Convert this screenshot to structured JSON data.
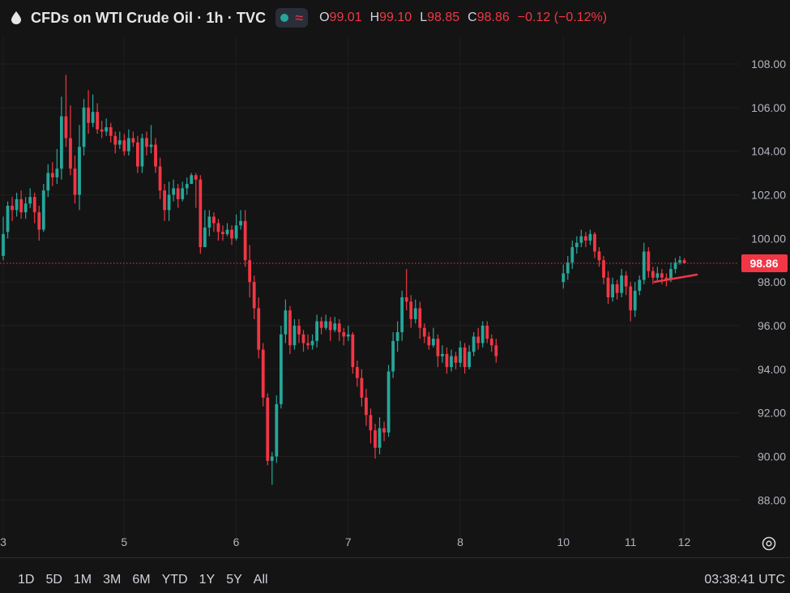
{
  "header": {
    "title": "CFDs on WTI Crude Oil · 1h · TVC",
    "open_label": "O",
    "open": "99.01",
    "high_label": "H",
    "high": "99.10",
    "low_label": "L",
    "low": "98.85",
    "close_label": "C",
    "close": "98.86",
    "change": "−0.12 (−0.12%)"
  },
  "price_tag": "98.86",
  "range_buttons": [
    "1D",
    "5D",
    "1M",
    "3M",
    "6M",
    "YTD",
    "1Y",
    "5Y",
    "All"
  ],
  "clock": "03:38:41 UTC",
  "colors": {
    "up": "#26a69a",
    "down": "#f23645",
    "background": "#141414",
    "grid": "#1f1f1f"
  },
  "chart_data": {
    "type": "candlestick",
    "title": "CFDs on WTI Crude Oil · 1h · TVC",
    "y_ticks": [
      "88.00",
      "90.00",
      "92.00",
      "94.00",
      "96.00",
      "98.00",
      "100.00",
      "102.00",
      "104.00",
      "106.00",
      "108.00"
    ],
    "ylim": [
      86.6,
      109.3
    ],
    "x_ticks": [
      {
        "label": "3",
        "x": 0
      },
      {
        "label": "5",
        "x": 27
      },
      {
        "label": "6",
        "x": 52
      },
      {
        "label": "7",
        "x": 77
      },
      {
        "label": "8",
        "x": 102
      },
      {
        "label": "10",
        "x": 125
      },
      {
        "label": "11",
        "x": 140
      },
      {
        "label": "12",
        "x": 152
      }
    ],
    "last_price": 98.86,
    "candles": [
      [
        0,
        99.2,
        100.2,
        101.0,
        99.0
      ],
      [
        1,
        100.3,
        101.5,
        101.7,
        100.0
      ],
      [
        2,
        101.5,
        101.3,
        101.9,
        100.8
      ],
      [
        3,
        101.3,
        101.8,
        102.1,
        101.0
      ],
      [
        4,
        101.8,
        101.2,
        102.2,
        100.9
      ],
      [
        5,
        101.2,
        101.6,
        101.9,
        100.9
      ],
      [
        6,
        101.6,
        101.9,
        102.3,
        101.4
      ],
      [
        7,
        101.9,
        101.2,
        102.1,
        100.7
      ],
      [
        8,
        101.2,
        100.4,
        101.5,
        99.9
      ],
      [
        9,
        100.4,
        102.2,
        102.5,
        100.3
      ],
      [
        10,
        102.2,
        103.0,
        103.4,
        101.9
      ],
      [
        11,
        103.0,
        102.8,
        103.5,
        102.4
      ],
      [
        12,
        102.8,
        103.2,
        104.1,
        102.5
      ],
      [
        13,
        103.2,
        105.6,
        106.5,
        102.7
      ],
      [
        14,
        105.6,
        104.6,
        107.5,
        104.2
      ],
      [
        15,
        104.6,
        103.2,
        106.1,
        102.9
      ],
      [
        16,
        103.2,
        102.0,
        103.8,
        101.6
      ],
      [
        17,
        102.0,
        104.2,
        105.2,
        101.3
      ],
      [
        18,
        104.2,
        106.0,
        106.4,
        103.8
      ],
      [
        19,
        106.0,
        105.3,
        106.8,
        104.8
      ],
      [
        20,
        105.3,
        105.8,
        106.6,
        105.1
      ],
      [
        21,
        105.8,
        105.0,
        106.2,
        104.8
      ],
      [
        22,
        105.0,
        104.9,
        105.4,
        104.6
      ],
      [
        23,
        104.9,
        105.1,
        105.5,
        104.7
      ],
      [
        24,
        105.1,
        104.7,
        105.3,
        104.4
      ],
      [
        25,
        104.7,
        104.3,
        104.9,
        103.9
      ],
      [
        26,
        104.3,
        104.5,
        104.9,
        104.1
      ],
      [
        27,
        104.5,
        104.0,
        104.8,
        103.8
      ],
      [
        28,
        104.0,
        104.6,
        105.0,
        103.8
      ],
      [
        29,
        104.6,
        104.4,
        104.9,
        104.2
      ],
      [
        30,
        104.4,
        103.3,
        104.7,
        103.0
      ],
      [
        31,
        103.3,
        104.6,
        104.8,
        103.0
      ],
      [
        32,
        104.6,
        104.2,
        104.9,
        103.8
      ],
      [
        33,
        104.2,
        104.3,
        105.2,
        103.9
      ],
      [
        34,
        104.3,
        103.3,
        104.6,
        103.0
      ],
      [
        35,
        103.3,
        102.2,
        103.7,
        101.8
      ],
      [
        36,
        102.2,
        101.3,
        102.5,
        100.8
      ],
      [
        37,
        101.3,
        102.0,
        102.6,
        100.8
      ],
      [
        38,
        102.0,
        102.3,
        102.7,
        101.7
      ],
      [
        39,
        102.3,
        101.8,
        102.5,
        101.4
      ],
      [
        40,
        101.8,
        102.3,
        102.6,
        101.7
      ],
      [
        41,
        102.3,
        102.5,
        102.8,
        102.0
      ],
      [
        42,
        102.5,
        102.9,
        103.0,
        102.5
      ],
      [
        43,
        102.9,
        102.7,
        103.0,
        101.4
      ],
      [
        44,
        102.7,
        99.6,
        102.9,
        99.3
      ],
      [
        45,
        99.6,
        100.5,
        101.3,
        99.6
      ],
      [
        46,
        100.5,
        101.0,
        101.3,
        100.1
      ],
      [
        47,
        101.0,
        100.7,
        101.2,
        100.3
      ],
      [
        48,
        100.7,
        100.3,
        100.9,
        99.9
      ],
      [
        49,
        100.3,
        100.2,
        100.6,
        99.9
      ],
      [
        50,
        100.2,
        100.4,
        100.7,
        100.1
      ],
      [
        51,
        100.4,
        100.0,
        100.6,
        99.7
      ],
      [
        52,
        100.0,
        100.6,
        101.1,
        99.9
      ],
      [
        53,
        100.6,
        100.8,
        101.3,
        100.4
      ],
      [
        54,
        100.8,
        99.0,
        101.3,
        98.7
      ],
      [
        55,
        99.0,
        98.0,
        99.7,
        97.3
      ],
      [
        56,
        98.0,
        96.8,
        98.3,
        96.3
      ],
      [
        57,
        96.8,
        94.9,
        97.3,
        94.5
      ],
      [
        58,
        94.9,
        92.7,
        95.2,
        92.3
      ],
      [
        59,
        92.7,
        89.8,
        92.9,
        89.6
      ],
      [
        60,
        89.8,
        90.0,
        90.2,
        88.7
      ],
      [
        61,
        90.0,
        92.4,
        92.8,
        89.7
      ],
      [
        62,
        92.4,
        95.6,
        96.0,
        92.2
      ],
      [
        63,
        95.6,
        96.7,
        97.2,
        95.2
      ],
      [
        64,
        96.7,
        95.1,
        96.9,
        94.7
      ],
      [
        65,
        95.1,
        96.0,
        96.3,
        94.9
      ],
      [
        66,
        96.0,
        95.6,
        96.3,
        95.2
      ],
      [
        67,
        95.6,
        95.2,
        95.8,
        94.8
      ],
      [
        68,
        95.2,
        95.1,
        95.6,
        94.9
      ],
      [
        69,
        95.1,
        95.3,
        95.6,
        94.9
      ],
      [
        70,
        95.3,
        96.2,
        96.5,
        95.0
      ],
      [
        71,
        96.2,
        95.9,
        96.4,
        95.6
      ],
      [
        72,
        95.9,
        96.2,
        96.5,
        95.8
      ],
      [
        73,
        96.2,
        95.8,
        96.4,
        95.3
      ],
      [
        74,
        95.8,
        96.1,
        96.4,
        95.7
      ],
      [
        75,
        96.1,
        95.7,
        96.3,
        95.3
      ],
      [
        76,
        95.7,
        95.5,
        95.9,
        95.1
      ],
      [
        77,
        95.5,
        95.6,
        96.0,
        95.3
      ],
      [
        78,
        95.6,
        94.1,
        95.7,
        93.8
      ],
      [
        79,
        94.1,
        93.6,
        94.4,
        93.2
      ],
      [
        80,
        93.6,
        92.7,
        94.0,
        92.3
      ],
      [
        81,
        92.7,
        91.9,
        93.1,
        91.4
      ],
      [
        82,
        91.9,
        91.2,
        92.2,
        90.6
      ],
      [
        83,
        91.2,
        90.4,
        91.5,
        89.9
      ],
      [
        84,
        90.4,
        91.3,
        91.8,
        90.1
      ],
      [
        85,
        91.3,
        91.1,
        91.6,
        90.7
      ],
      [
        86,
        91.1,
        93.9,
        94.2,
        90.9
      ],
      [
        87,
        93.9,
        95.3,
        95.7,
        93.6
      ],
      [
        88,
        95.3,
        95.7,
        96.2,
        94.8
      ],
      [
        89,
        95.7,
        97.3,
        97.6,
        95.3
      ],
      [
        90,
        97.3,
        97.1,
        98.6,
        96.7
      ],
      [
        91,
        97.1,
        96.3,
        97.4,
        95.9
      ],
      [
        92,
        96.3,
        96.8,
        97.2,
        96.1
      ],
      [
        93,
        96.8,
        95.9,
        97.1,
        95.4
      ],
      [
        94,
        95.9,
        95.5,
        96.1,
        95.2
      ],
      [
        95,
        95.5,
        95.1,
        95.7,
        94.9
      ],
      [
        96,
        95.1,
        95.4,
        95.9,
        95.0
      ],
      [
        97,
        95.4,
        94.6,
        95.6,
        94.1
      ],
      [
        98,
        94.6,
        94.7,
        95.1,
        94.3
      ],
      [
        99,
        94.7,
        94.1,
        95.0,
        93.8
      ],
      [
        100,
        94.1,
        94.6,
        94.9,
        93.9
      ],
      [
        101,
        94.6,
        94.3,
        94.8,
        94.0
      ],
      [
        102,
        94.3,
        95.0,
        95.3,
        94.1
      ],
      [
        103,
        95.0,
        94.1,
        95.2,
        93.8
      ],
      [
        104,
        94.1,
        94.8,
        95.1,
        94.0
      ],
      [
        105,
        94.8,
        95.5,
        95.7,
        94.6
      ],
      [
        106,
        95.5,
        95.2,
        95.9,
        94.9
      ],
      [
        107,
        95.2,
        96.0,
        96.2,
        95.0
      ],
      [
        108,
        96.0,
        95.4,
        96.2,
        95.2
      ],
      [
        109,
        95.4,
        95.1,
        95.6,
        94.8
      ],
      [
        110,
        95.1,
        94.6,
        95.4,
        94.3
      ],
      [
        125,
        98.0,
        98.4,
        98.8,
        97.7
      ],
      [
        126,
        98.4,
        98.9,
        99.2,
        98.1
      ],
      [
        127,
        98.9,
        99.6,
        99.9,
        98.6
      ],
      [
        128,
        99.6,
        99.8,
        100.1,
        99.3
      ],
      [
        129,
        99.8,
        100.1,
        100.4,
        99.6
      ],
      [
        130,
        100.1,
        99.9,
        100.3,
        99.6
      ],
      [
        131,
        99.9,
        100.2,
        100.4,
        99.7
      ],
      [
        132,
        100.2,
        99.4,
        100.3,
        99.1
      ],
      [
        133,
        99.4,
        99.0,
        99.6,
        98.7
      ],
      [
        134,
        99.0,
        98.2,
        99.2,
        97.9
      ],
      [
        135,
        98.2,
        97.3,
        98.5,
        97.0
      ],
      [
        136,
        97.3,
        97.9,
        98.2,
        97.1
      ],
      [
        137,
        97.9,
        97.5,
        98.1,
        97.2
      ],
      [
        138,
        97.5,
        98.3,
        98.6,
        97.3
      ],
      [
        139,
        98.3,
        97.8,
        98.5,
        97.4
      ],
      [
        140,
        97.8,
        96.7,
        98.0,
        96.2
      ],
      [
        141,
        96.7,
        97.6,
        98.0,
        96.4
      ],
      [
        142,
        97.6,
        98.1,
        98.3,
        97.4
      ],
      [
        143,
        98.1,
        99.4,
        99.8,
        97.9
      ],
      [
        144,
        99.4,
        98.5,
        99.6,
        98.2
      ],
      [
        145,
        98.5,
        98.2,
        98.7,
        97.9
      ],
      [
        146,
        98.2,
        98.4,
        98.7,
        98.0
      ],
      [
        147,
        98.4,
        98.2,
        98.6,
        97.9
      ],
      [
        148,
        98.2,
        98.1,
        98.4,
        97.8
      ],
      [
        149,
        98.1,
        98.6,
        98.9,
        98.0
      ],
      [
        150,
        98.6,
        98.9,
        99.1,
        98.4
      ],
      [
        151,
        98.9,
        99.0,
        99.2,
        98.8
      ],
      [
        152,
        99.0,
        98.86,
        99.1,
        98.85
      ]
    ]
  }
}
